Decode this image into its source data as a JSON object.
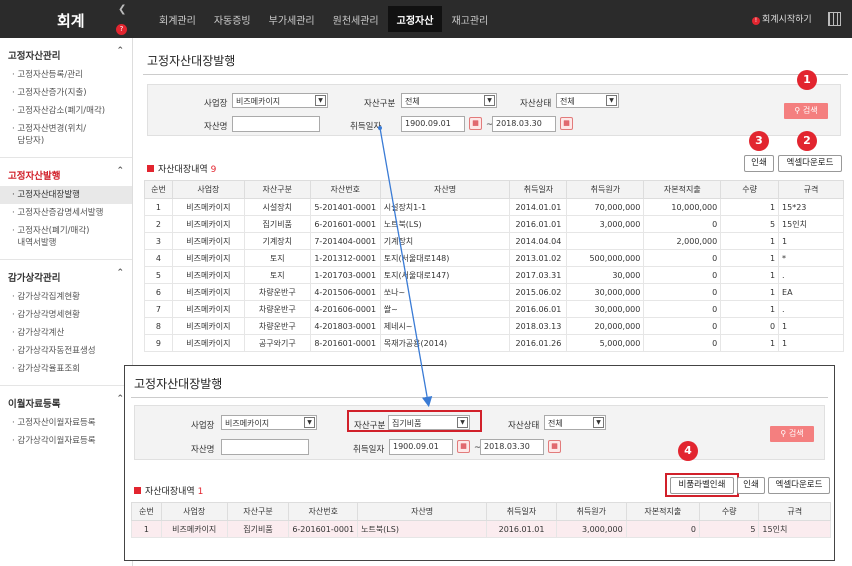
{
  "header": {
    "brand": "회계",
    "collapse_icon": "chevron-left-icon",
    "help_icon": "headset-icon",
    "nav": [
      "회계관리",
      "자동증빙",
      "부가세관리",
      "원천세관리",
      "고정자산",
      "재고관리"
    ],
    "active_nav": "고정자산",
    "start_label": "회계시작하기",
    "calc_icon": "calculator-icon"
  },
  "sidebar": {
    "groups": [
      {
        "title": "고정자산관리",
        "items": [
          "고정자산등록/관리",
          "고정자산증가(지출)",
          "고정자산감소(폐기/매각)",
          "고정자산변경(위치/",
          "담당자)"
        ]
      },
      {
        "title": "고정자산발행",
        "items": [
          "고정자산대장발행",
          "고정자산증감명세서발행",
          "고정자산(폐기/매각)",
          "내역서발행"
        ]
      },
      {
        "title": "감가상각관리",
        "items": [
          "감가상각집계현황",
          "감가상각명세현황",
          "감가상각계산",
          "감가상각자동전표생성",
          "감가상각율표조회"
        ]
      },
      {
        "title": "이월자료등록",
        "items": [
          "고정자산이월자료등록",
          "감가상각이월자료등록"
        ]
      }
    ]
  },
  "main": {
    "title": "고정자산대장발행",
    "filters": {
      "biz_label": "사업장",
      "biz_value": "비즈메카이지",
      "type_label": "자산구분",
      "type_value": "전체",
      "status_label": "자산상태",
      "status_value": "전체",
      "name_label": "자산명",
      "name_value": "",
      "date_label": "취득일자",
      "date_from": "1900.09.01",
      "date_sep": "~",
      "date_to": "2018.03.30"
    },
    "search_button": "검색",
    "print_button": "인쇄",
    "excel_button": "엑셀다운로드",
    "section_label": "자산대장내역",
    "section_count": "9",
    "columns": [
      "순번",
      "사업장",
      "자산구분",
      "자산번호",
      "자산명",
      "취득일자",
      "취득원가",
      "자본적지출",
      "수량",
      "규격"
    ],
    "rows": [
      [
        "1",
        "비즈메카이지",
        "시설장치",
        "5-201401-0001",
        "시설장치1-1",
        "2014.01.01",
        "70,000,000",
        "10,000,000",
        "1",
        "15*23"
      ],
      [
        "2",
        "비즈메카이지",
        "집기비품",
        "6-201601-0001",
        "노트북(LS)",
        "2016.01.01",
        "3,000,000",
        "0",
        "5",
        "15인치"
      ],
      [
        "3",
        "비즈메카이지",
        "기계장치",
        "7-201404-0001",
        "기계장치",
        "2014.04.04",
        "",
        "2,000,000",
        "1",
        "1"
      ],
      [
        "4",
        "비즈메카이지",
        "토지",
        "1-201312-0001",
        "토지(서울대로148)",
        "2013.01.02",
        "500,000,000",
        "0",
        "1",
        "*"
      ],
      [
        "5",
        "비즈메카이지",
        "토지",
        "1-201703-0001",
        "토지(서울대로147)",
        "2017.03.31",
        "30,000",
        "0",
        "1",
        "."
      ],
      [
        "6",
        "비즈메카이지",
        "차량운반구",
        "4-201506-0001",
        "쏘나~",
        "2015.06.02",
        "30,000,000",
        "0",
        "1",
        "EA"
      ],
      [
        "7",
        "비즈메카이지",
        "차량운반구",
        "4-201606-0001",
        "쏼~",
        "2016.06.01",
        "30,000,000",
        "0",
        "1",
        "."
      ],
      [
        "8",
        "비즈메카이지",
        "차량운반구",
        "4-201803-0001",
        "제네시~",
        "2018.03.13",
        "20,000,000",
        "0",
        "0",
        "1"
      ],
      [
        "9",
        "비즈메카이지",
        "공구와기구",
        "8-201601-0001",
        "목재가공용(2014)",
        "2016.01.26",
        "5,000,000",
        "0",
        "1",
        "1"
      ]
    ]
  },
  "overlay": {
    "title": "고정자산대장발행",
    "filters": {
      "biz_label": "사업장",
      "biz_value": "비즈메카이지",
      "type_label": "자산구분",
      "type_value": "집기비품",
      "status_label": "자산상태",
      "status_value": "전체",
      "name_label": "자산명",
      "name_value": "",
      "date_label": "취득일자",
      "date_from": "1900.09.01",
      "date_sep": "~",
      "date_to": "2018.03.30"
    },
    "search_button": "검색",
    "label_print_button": "비품라벨인쇄",
    "print_button": "인쇄",
    "excel_button": "엑셀다운로드",
    "section_label": "자산대장내역",
    "section_count": "1",
    "columns": [
      "순번",
      "사업장",
      "자산구분",
      "자산번호",
      "자산명",
      "취득일자",
      "취득원가",
      "자본적지출",
      "수량",
      "규격"
    ],
    "rows": [
      [
        "1",
        "비즈메카이지",
        "집기비품",
        "6-201601-0001",
        "노트북(LS)",
        "2016.01.01",
        "3,000,000",
        "0",
        "5",
        "15인치"
      ]
    ]
  },
  "markers": [
    "1",
    "2",
    "3",
    "4"
  ],
  "colors": {
    "accent": "#e2252f",
    "search_button": "#f47f7f",
    "topbar": "#2b2b2b"
  }
}
